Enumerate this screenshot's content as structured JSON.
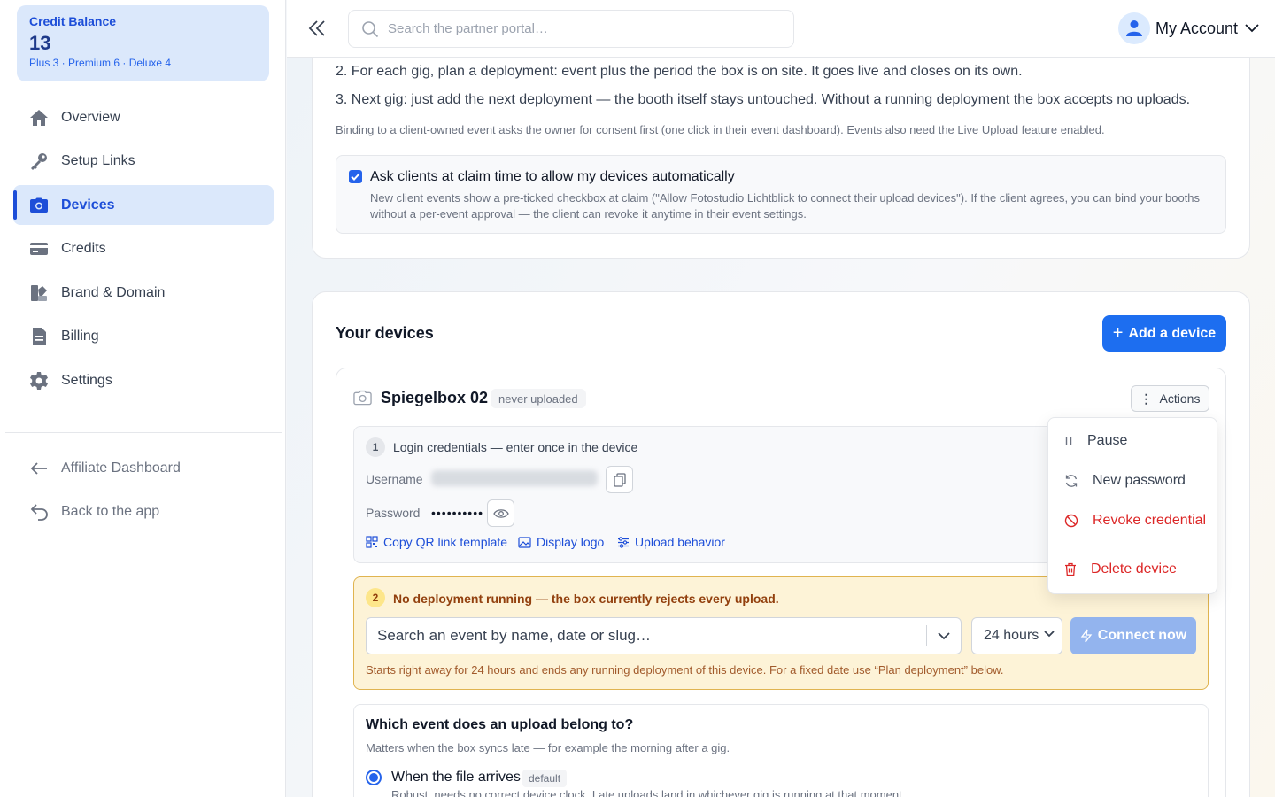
{
  "sidebar": {
    "credit": {
      "title": "Credit Balance",
      "value": "13",
      "breakdown": "Plus 3 · Premium 6 · Deluxe 4"
    },
    "items": [
      {
        "label": "Overview",
        "icon": "home-icon"
      },
      {
        "label": "Setup Links",
        "icon": "key-icon"
      },
      {
        "label": "Devices",
        "icon": "camera-icon",
        "active": true
      },
      {
        "label": "Credits",
        "icon": "card-icon"
      },
      {
        "label": "Brand & Domain",
        "icon": "brand-icon"
      },
      {
        "label": "Billing",
        "icon": "document-icon"
      },
      {
        "label": "Settings",
        "icon": "gear-icon"
      }
    ],
    "secondary": [
      {
        "label": "Affiliate Dashboard",
        "icon": "arrow-left-icon"
      },
      {
        "label": "Back to the app",
        "icon": "return-icon"
      }
    ]
  },
  "topbar": {
    "search_placeholder": "Search the partner portal…",
    "account_label": "My Account"
  },
  "info": {
    "step2": "2. For each gig, plan a deployment: event plus the period the box is on site. It goes live and closes on its own.",
    "step3": "3. Next gig: just add the next deployment — the booth itself stays untouched. Without a running deployment the box accepts no uploads.",
    "note": "Binding to a client-owned event asks the owner for consent first (one click in their event dashboard). Events also need the Live Upload feature enabled.",
    "auto_allow": {
      "checked": true,
      "title": "Ask clients at claim time to allow my devices automatically",
      "description": "New client events show a pre-ticked checkbox at claim (\"Allow Fotostudio Lichtblick to connect their upload devices\"). If the client agrees, you can bind your booths without a per-event approval — the client can revoke it anytime in their event settings."
    }
  },
  "devices": {
    "heading": "Your devices",
    "add_label": "Add a device",
    "device": {
      "name": "Spiegelbox 02",
      "badge": "never uploaded",
      "actions_label": "Actions",
      "login": {
        "step": "1",
        "title": "Login credentials — enter once in the device",
        "username_label": "Username",
        "password_label": "Password",
        "password_mask": "••••••••••",
        "links": {
          "qr": "Copy QR link template",
          "logo": "Display logo",
          "upload": "Upload behavior"
        }
      },
      "deployment": {
        "step": "2",
        "title": "No deployment running — the box currently rejects every upload.",
        "event_placeholder": "Search an event by name, date or slug…",
        "duration": "24 hours",
        "connect_label": "Connect now",
        "note": "Starts right away for 24 hours and ends any running deployment of this device. For a fixed date use “Plan deployment” below."
      },
      "assignment": {
        "title": "Which event does an upload belong to?",
        "subtitle": "Matters when the box syncs late — for example the morning after a gig.",
        "option1_label": "When the file arrives",
        "option1_badge": "default",
        "option1_desc": "Robust, needs no correct device clock. Late uploads land in whichever gig is running at that moment."
      }
    },
    "menu": {
      "pause": "Pause",
      "new_password": "New password",
      "revoke": "Revoke credential",
      "delete": "Delete device"
    }
  },
  "colors": {
    "accent": "#1d6ef0",
    "danger": "#dc2626",
    "warning_bg": "#fdf3d7",
    "warning_border": "#e0b450"
  }
}
